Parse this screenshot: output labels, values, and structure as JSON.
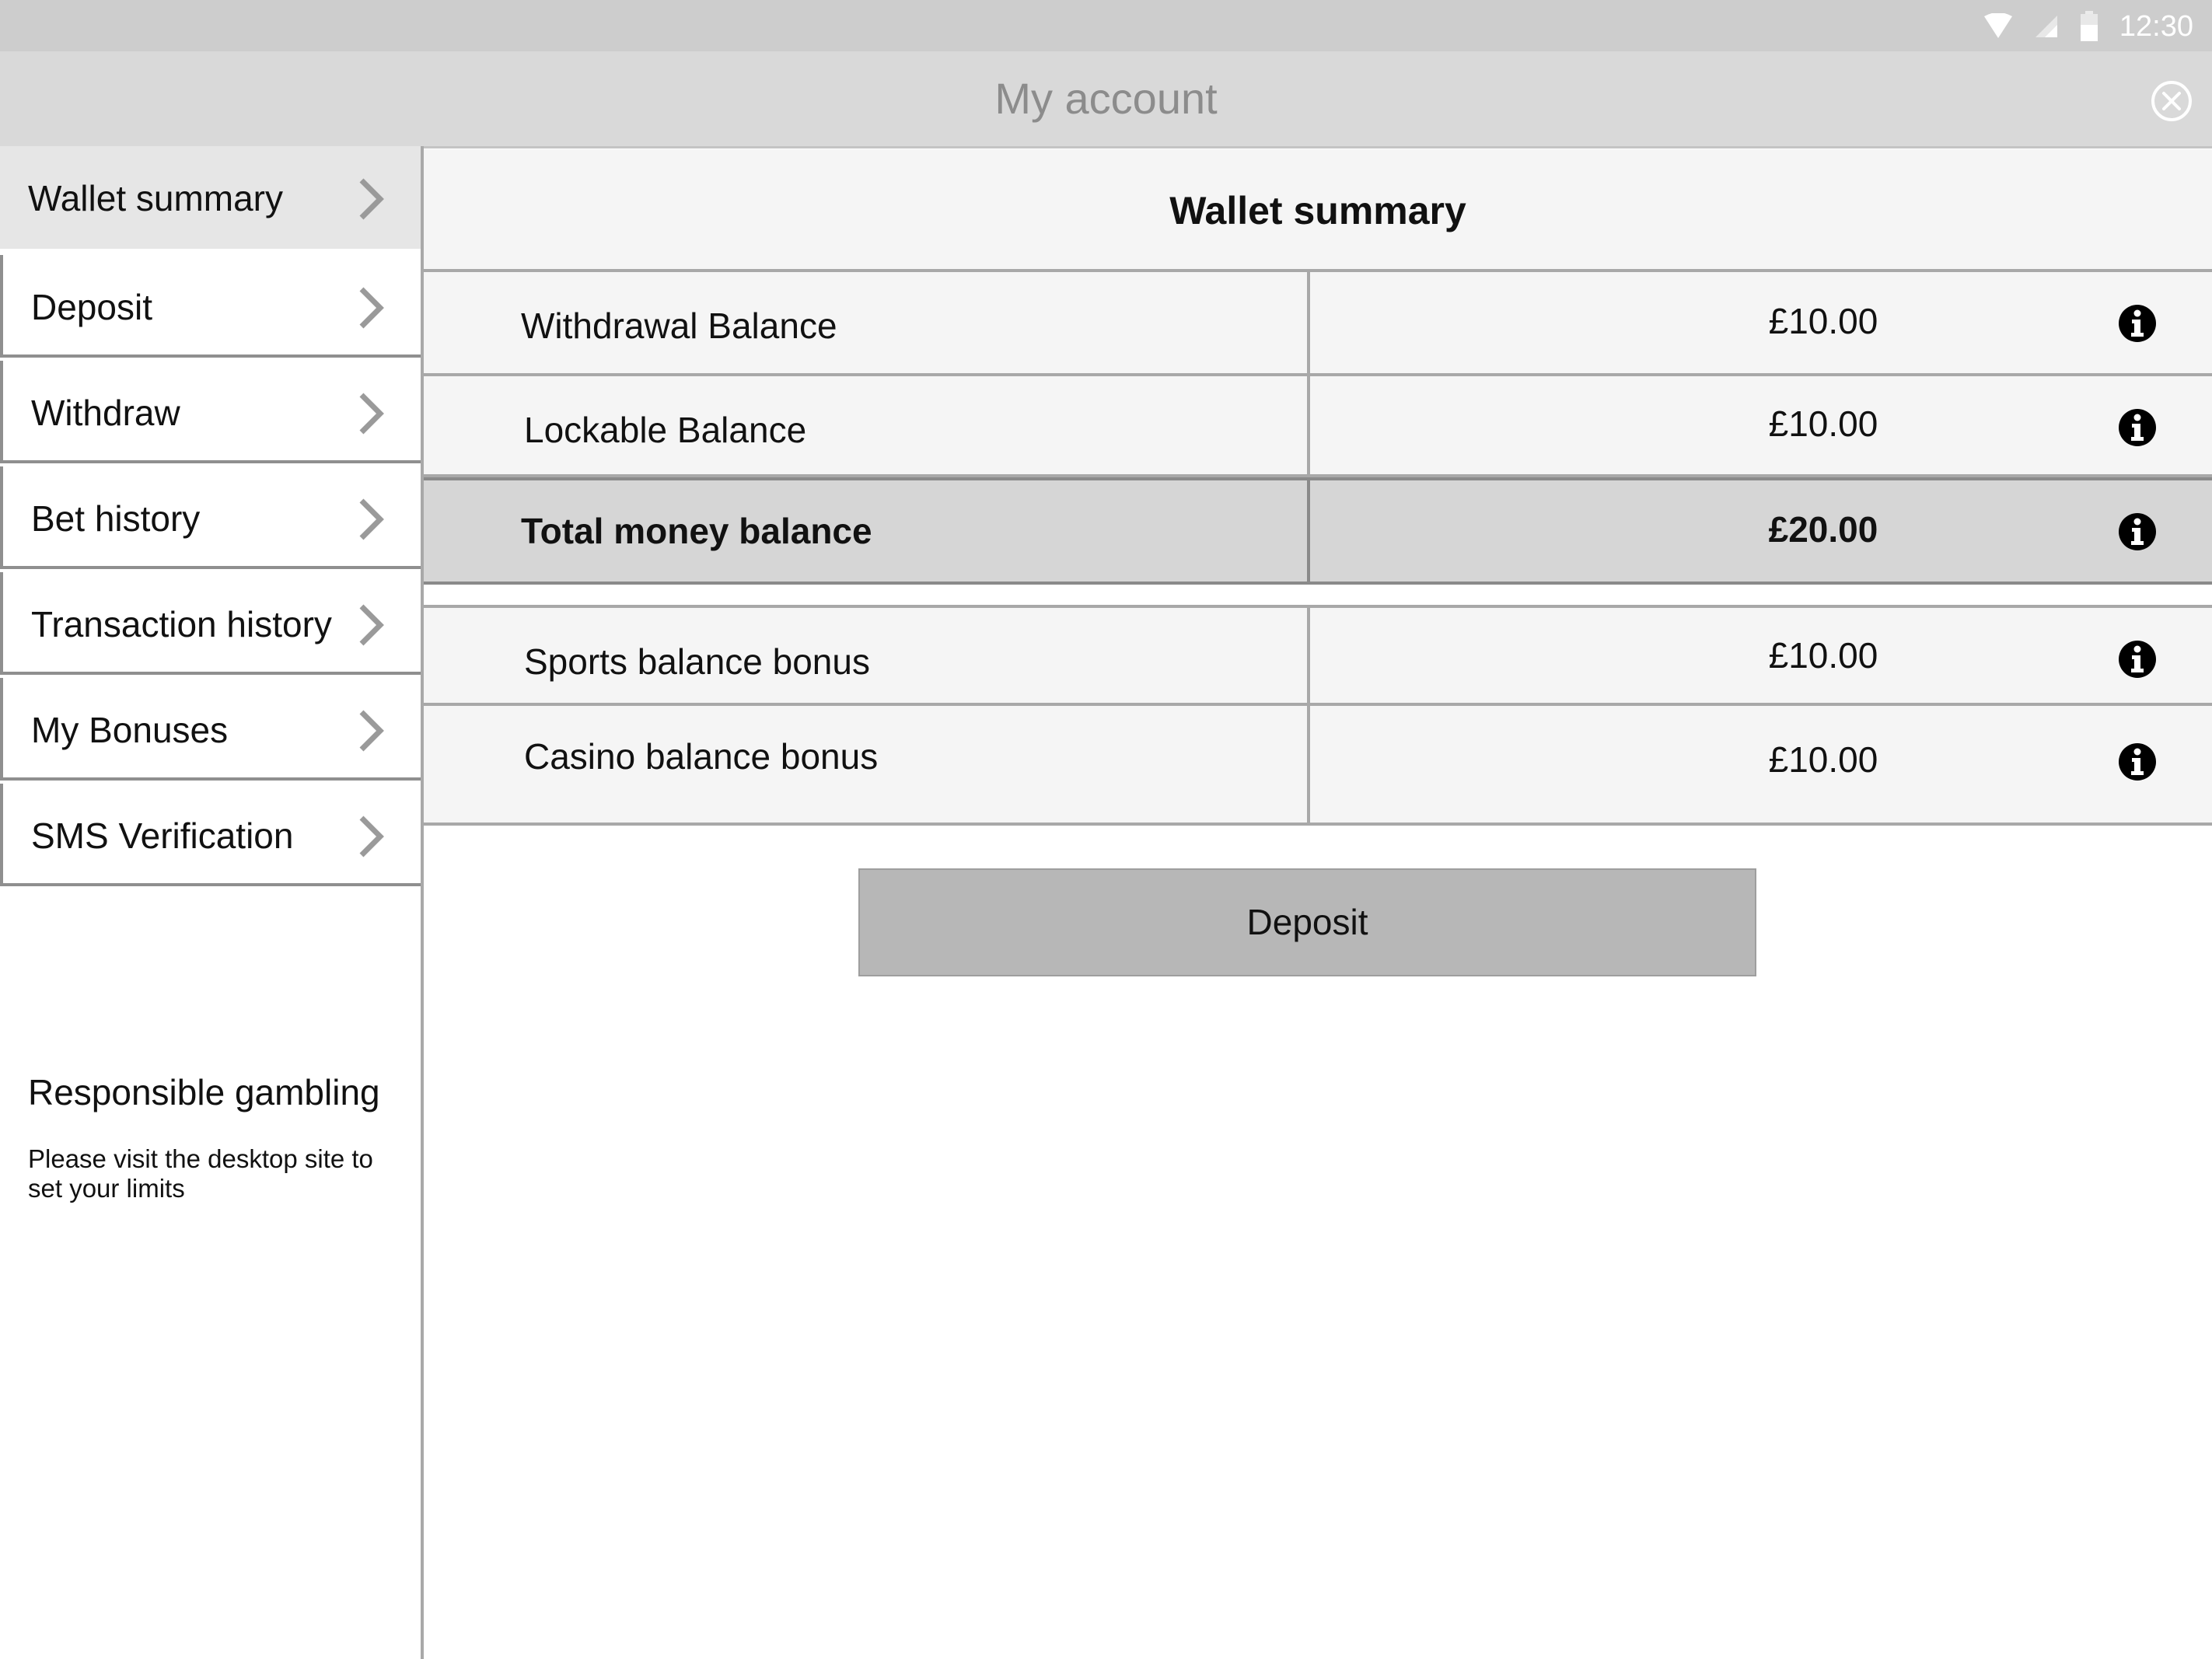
{
  "status_bar": {
    "time": "12:30",
    "icons": [
      "wifi-icon",
      "signal-icon",
      "battery-icon"
    ]
  },
  "header": {
    "title": "My account",
    "close_icon": "close-circle-icon"
  },
  "sidebar": {
    "items": [
      {
        "label": "Wallet summary",
        "active": true
      },
      {
        "label": "Deposit"
      },
      {
        "label": "Withdraw"
      },
      {
        "label": "Bet history"
      },
      {
        "label": "Transaction history"
      },
      {
        "label": "My Bonuses"
      },
      {
        "label": "SMS Verification"
      }
    ],
    "responsible": {
      "title": "Responsible gambling",
      "text": "Please visit the desktop site to set your limits"
    }
  },
  "main": {
    "title": "Wallet summary",
    "rows": [
      {
        "label": "Withdrawal Balance",
        "value": "£10.00"
      },
      {
        "label": "Lockable Balance",
        "value": "£10.00"
      },
      {
        "label": "Total money balance",
        "value": "£20.00"
      },
      {
        "label": "Sports balance bonus",
        "value": "£10.00"
      },
      {
        "label": "Casino balance bonus",
        "value": "£10.00"
      }
    ],
    "deposit_label": "Deposit"
  },
  "colors": {
    "header_bg": "#d9d9d9",
    "status_bg": "#cdcdcd",
    "button_bg": "#b7b7b7",
    "total_bg": "#d6d6d6"
  }
}
